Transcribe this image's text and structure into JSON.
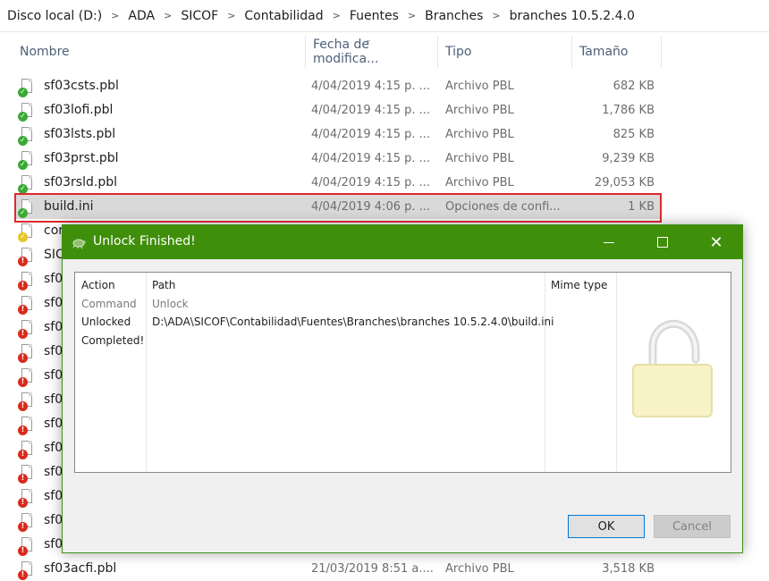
{
  "breadcrumb": [
    "Disco local (D:)",
    "ADA",
    "SICOF",
    "Contabilidad",
    "Fuentes",
    "Branches",
    "branches 10.5.2.4.0"
  ],
  "columns": {
    "name": "Nombre",
    "date": "Fecha de modifica...",
    "type": "Tipo",
    "size": "Tamaño"
  },
  "files": [
    {
      "name": "sf03csts.pbl",
      "date": "4/04/2019 4:15 p. ...",
      "type": "Archivo PBL",
      "size": "682 KB",
      "status": "green"
    },
    {
      "name": "sf03lofi.pbl",
      "date": "4/04/2019 4:15 p. ...",
      "type": "Archivo PBL",
      "size": "1,786 KB",
      "status": "green"
    },
    {
      "name": "sf03lsts.pbl",
      "date": "4/04/2019 4:15 p. ...",
      "type": "Archivo PBL",
      "size": "825 KB",
      "status": "green"
    },
    {
      "name": "sf03prst.pbl",
      "date": "4/04/2019 4:15 p. ...",
      "type": "Archivo PBL",
      "size": "9,239 KB",
      "status": "green"
    },
    {
      "name": "sf03rsld.pbl",
      "date": "4/04/2019 4:15 p. ...",
      "type": "Archivo PBL",
      "size": "29,053 KB",
      "status": "green"
    },
    {
      "name": "build.ini",
      "date": "4/04/2019 4:06 p. ...",
      "type": "Opciones de confi...",
      "size": "1 KB",
      "status": "green",
      "selected": true
    },
    {
      "name": "cor",
      "date": "",
      "type": "",
      "size": "",
      "status": "yellow"
    },
    {
      "name": "SIC",
      "date": "",
      "type": "",
      "size": "",
      "status": "red"
    },
    {
      "name": "sf0",
      "date": "",
      "type": "",
      "size": "",
      "status": "red"
    },
    {
      "name": "sf0",
      "date": "",
      "type": "",
      "size": "",
      "status": "red"
    },
    {
      "name": "sf0",
      "date": "",
      "type": "",
      "size": "",
      "status": "red"
    },
    {
      "name": "sf0",
      "date": "",
      "type": "",
      "size": "",
      "status": "red"
    },
    {
      "name": "sf0",
      "date": "",
      "type": "",
      "size": "",
      "status": "red"
    },
    {
      "name": "sf0",
      "date": "",
      "type": "",
      "size": "",
      "status": "red"
    },
    {
      "name": "sf0",
      "date": "",
      "type": "",
      "size": "",
      "status": "red"
    },
    {
      "name": "sf0",
      "date": "",
      "type": "",
      "size": "",
      "status": "red"
    },
    {
      "name": "sf0",
      "date": "",
      "type": "",
      "size": "",
      "status": "red"
    },
    {
      "name": "sf0",
      "date": "",
      "type": "",
      "size": "",
      "status": "red"
    },
    {
      "name": "sf0",
      "date": "",
      "type": "",
      "size": "",
      "status": "red"
    },
    {
      "name": "sf0",
      "date": "",
      "type": "",
      "size": "",
      "status": "red"
    },
    {
      "name": "sf03acfi.pbl",
      "date": "21/03/2019 8:51 a....",
      "type": "Archivo PBL",
      "size": "3,518 KB",
      "status": "red"
    }
  ],
  "dialog": {
    "title": "Unlock Finished!",
    "headers": {
      "action": "Action",
      "path": "Path",
      "mime": "Mime type"
    },
    "rows": [
      {
        "action": "Command",
        "path": "Unlock"
      },
      {
        "action": "Unlocked",
        "path": "D:\\ADA\\SICOF\\Contabilidad\\Fuentes\\Branches\\branches 10.5.2.4.0\\build.ini"
      },
      {
        "action": "Completed!",
        "path": ""
      }
    ],
    "ok_label": "OK",
    "cancel_label": "Cancel"
  },
  "icons": {
    "title": "tortoise-icon",
    "lock": "unlocked-padlock-icon"
  },
  "colors": {
    "accent": "#3f8f0a",
    "selection_outline": "#e0282e",
    "row_selected": "#d9d9d9"
  }
}
